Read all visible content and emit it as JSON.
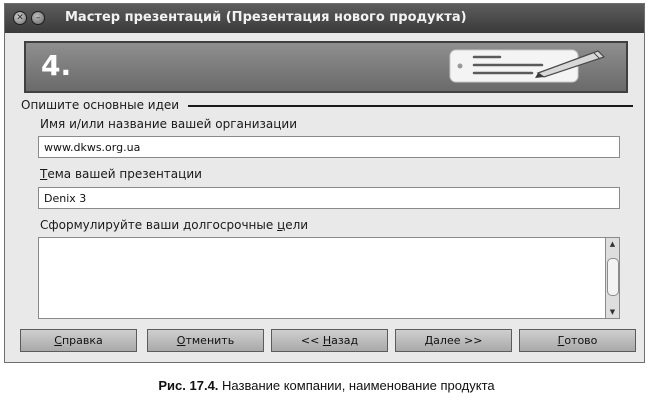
{
  "window": {
    "title": "Мастер презентаций (Презентация нового продукта)"
  },
  "banner": {
    "step": "4.",
    "icon": "pen-and-note-icon"
  },
  "group": {
    "label": "Опишите основные идеи"
  },
  "fields": {
    "organization_label": "Имя и/или название вашей организации",
    "organization_value": "www.dkws.org.ua",
    "topic_label_mnemonic": "Т",
    "topic_label_rest": "ема вашей презентации",
    "topic_value": "Denix 3",
    "goals_label_start": "Сформулируйте ваши долгосрочные ",
    "goals_label_mnemonic": "ц",
    "goals_label_end": "ели",
    "goals_value": ""
  },
  "buttons": {
    "help_mnemonic": "С",
    "help_rest": "правка",
    "cancel_mnemonic": "О",
    "cancel_rest": "тменить",
    "back_start": "<< ",
    "back_mnemonic": "Н",
    "back_end": "азад",
    "next_mnemonic": "Д",
    "next_rest": "алее >>",
    "finish_mnemonic": "Г",
    "finish_rest": "отово"
  },
  "caption": {
    "figure": "Рис. 17.4.",
    "text": " Название компании, наименование продукта"
  },
  "colors": {
    "titlebar": "#4a4a4a",
    "window_bg": "#e9e9e9",
    "banner": "#7d7d7d",
    "button": "#bdbdbd"
  }
}
